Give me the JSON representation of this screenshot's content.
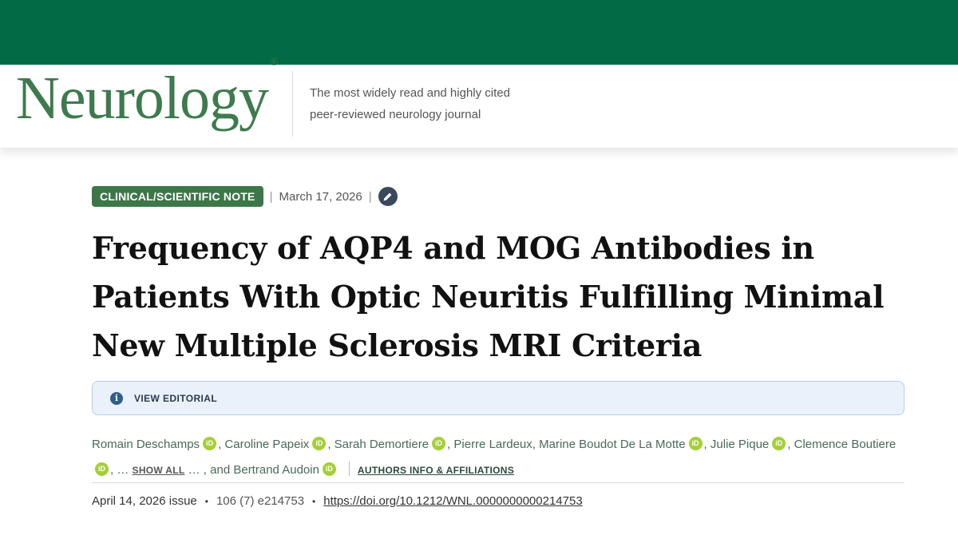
{
  "header": {
    "logo_text": "Neurology",
    "logo_mark": "®",
    "tagline_line1": "The most widely read and highly cited",
    "tagline_line2": "peer-reviewed neurology journal",
    "brand_color": "#006b45"
  },
  "article": {
    "type_badge": "CLINICAL/SCIENTIFIC NOTE",
    "separator": "|",
    "published_date": "March 17, 2026",
    "title": "Frequency of AQP4 and MOG Antibodies in Patients With Optic Neuritis Fulfilling Minimal New Multiple Sclerosis MRI Criteria",
    "editorial_label": "VIEW EDITORIAL",
    "info_glyph": "i",
    "authors": [
      "Romain Deschamps",
      "Caroline Papeix",
      "Sarah Demortiere",
      "Pierre Lardeux, Marine Boudot De La Motte",
      "Julie Pique",
      "Clemence Boutiere"
    ],
    "orcid_label": "iD",
    "ellipsis_before": ", …",
    "show_all_label": "SHOW ALL",
    "ellipsis_after": "… , and",
    "last_author": "Bertrand Audoin",
    "affiliations_label": "AUTHORS INFO & AFFILIATIONS",
    "issue_date": "April 14, 2026 issue",
    "volume_info": "106 (7) e214753",
    "doi": "https://doi.org/10.1212/WNL.0000000000214753",
    "bullet": "•"
  }
}
